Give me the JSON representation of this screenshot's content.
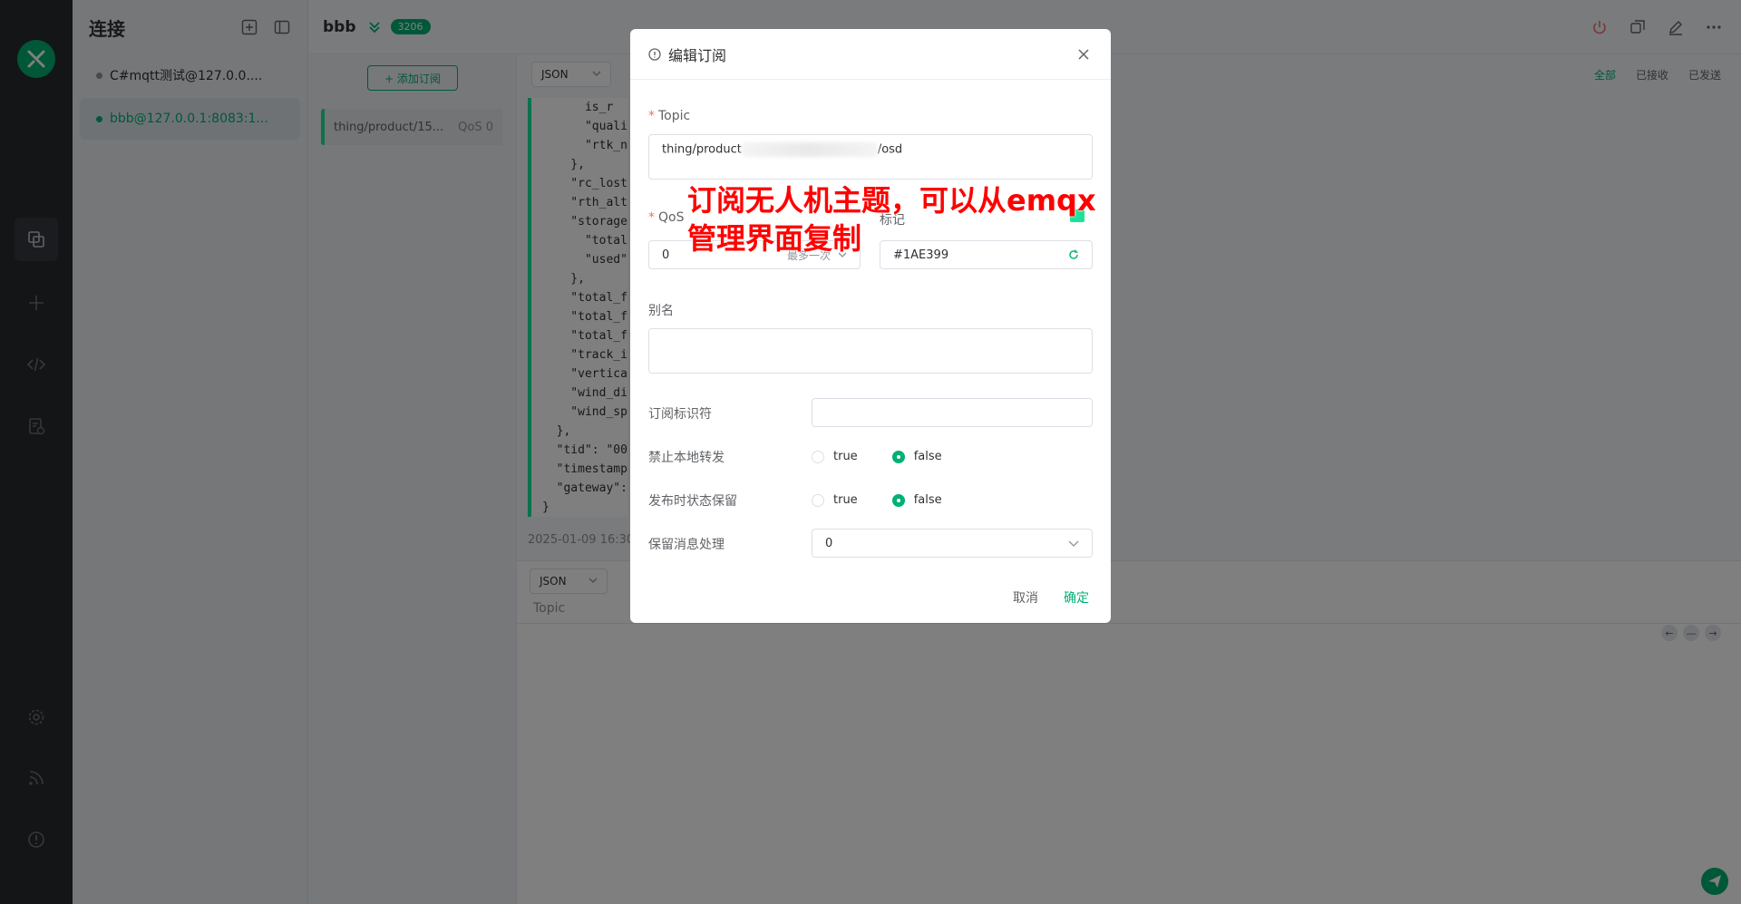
{
  "sidebar": {
    "title": "连接",
    "connections": [
      {
        "name": "C#mqtt测试@127.0.0....",
        "status_color": "#909399"
      },
      {
        "name": "bbb@127.0.0.1:8083:1...",
        "status_color": "#00b173"
      }
    ]
  },
  "header": {
    "connection_name": "bbb",
    "message_count": "3206"
  },
  "subscriptions": {
    "add_label": "+ 添加订阅",
    "items": [
      {
        "topic": "thing/product/15...",
        "qos": "QoS 0",
        "color": "#1ae399"
      }
    ]
  },
  "messages": {
    "format": "JSON",
    "filters": [
      "全部",
      "已接收",
      "已发送"
    ],
    "active_filter": "全部",
    "json_lines": [
      "      is_r",
      "      \"quali",
      "      \"rtk_n",
      "    },",
      "    \"rc_lost",
      "    \"rth_alt",
      "    \"storage",
      "      \"total",
      "      \"used\"",
      "    },",
      "    \"total_f",
      "    \"total_f",
      "    \"total_f",
      "    \"track_i",
      "    \"vertica",
      "    \"wind_di",
      "    \"wind_sp",
      "  },",
      "  \"tid\": \"00",
      "  \"timestamp",
      "  \"gateway\":",
      "}"
    ],
    "timestamp": "2025-01-09 16:30"
  },
  "composer": {
    "format": "JSON",
    "topic_placeholder": "Topic"
  },
  "dialog": {
    "title": "编辑订阅",
    "topic_label": "Topic",
    "topic_prefix": "thing/product",
    "topic_suffix": "/osd",
    "qos_label": "QoS",
    "qos_value": "0",
    "qos_desc": "最多一次",
    "color_label": "标记",
    "color_value": "#1AE399",
    "alias_label": "别名",
    "alias_value": "",
    "sub_id_label": "订阅标识符",
    "sub_id_value": "",
    "no_local_label": "禁止本地转发",
    "retain_as_published_label": "发布时状态保留",
    "retain_handling_label": "保留消息处理",
    "retain_handling_value": "0",
    "true_label": "true",
    "false_label": "false",
    "cancel_label": "取消",
    "confirm_label": "确定"
  },
  "annotation": {
    "line1": "订阅无人机主题，可以从emqx",
    "line2": "管理界面复制"
  },
  "colors": {
    "accent": "#00b173",
    "sidebar_bg": "#262a2f",
    "annotation": "#ff0000"
  }
}
